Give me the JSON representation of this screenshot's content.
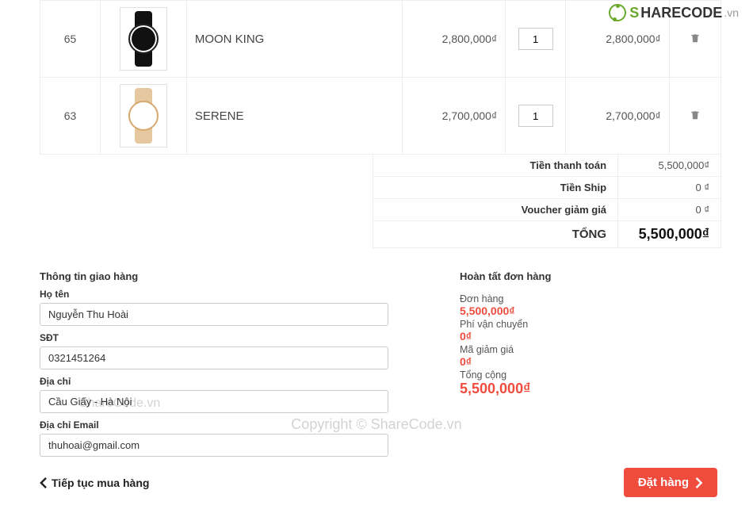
{
  "cart": {
    "rows": [
      {
        "id": "65",
        "name": "MOON KING",
        "price": "2,800,000₫",
        "qty": "1",
        "subtotal": "2,800,000₫",
        "thumb": "black"
      },
      {
        "id": "63",
        "name": "SERENE",
        "price": "2,700,000₫",
        "qty": "1",
        "subtotal": "2,700,000₫",
        "thumb": "gold"
      }
    ]
  },
  "summary": {
    "pay_label": "Tiền thanh toán",
    "pay_value": "5,500,000₫",
    "ship_label": "Tiền Ship",
    "ship_value": "0 ₫",
    "voucher_label": "Voucher giảm giá",
    "voucher_value": "0 ₫",
    "total_label": "TỔNG",
    "total_value": "5,500,000₫"
  },
  "shipping": {
    "heading": "Thông tin giao hàng",
    "name_label": "Họ tên",
    "name_value": "Nguyễn Thu Hoài",
    "phone_label": "SĐT",
    "phone_value": "0321451264",
    "addr_label": "Địa chỉ",
    "addr_value": "Cầu Giấy - Hà Nội",
    "email_label": "Địa chỉ Email",
    "email_value": "thuhoai@gmail.com"
  },
  "order": {
    "heading": "Hoàn tất đơn hàng",
    "order_label": "Đơn hàng",
    "order_amount": "5,500,000₫",
    "ship_label": "Phí vận chuyển",
    "ship_amount": "0₫",
    "voucher_label": "Mã giảm giá",
    "voucher_amount": "0₫",
    "total_label": "Tổng cộng",
    "total_amount": "5,500,000₫"
  },
  "buttons": {
    "continue": "Tiếp tục mua hàng",
    "order": "Đặt hàng"
  },
  "watermark": {
    "copyright": "Copyright © ShareCode.vn",
    "share": "ShareCode.vn",
    "logo_s": "S",
    "logo_hare": "HARECODE",
    "logo_vn": ".vn"
  }
}
